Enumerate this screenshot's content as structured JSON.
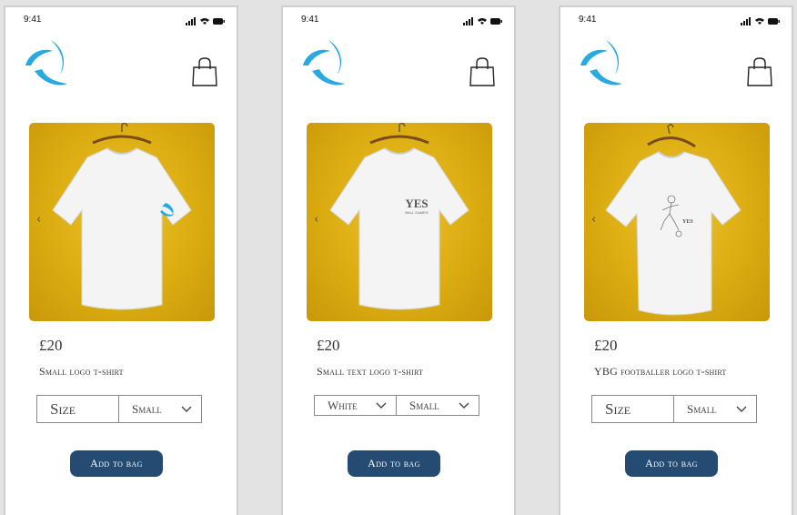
{
  "colors": {
    "accent": "#29a9e1",
    "button": "#244c72",
    "product_bg": "#dcad10"
  },
  "screens": [
    {
      "time": "9:41",
      "price": "£20",
      "name": "Small logo t-shirt",
      "print": "logo",
      "selectors": [
        "Size",
        "Small"
      ],
      "add_label": "Add to bag"
    },
    {
      "time": "9:41",
      "price": "£20",
      "name": "Small text logo t-shirt",
      "print": "text",
      "print_text": "YES",
      "print_subtext": "BALL GAMES",
      "selectors": [
        "White",
        "Small"
      ],
      "add_label": "Add to bag"
    },
    {
      "time": "9:41",
      "price": "£20",
      "name": "YBG footballer logo t-shirt",
      "print": "footballer",
      "print_text": "YES",
      "selectors": [
        "Size",
        "Small"
      ],
      "add_label": "Add to bag"
    }
  ],
  "icons": {
    "logo": "swirl-logo-icon",
    "bag": "shopping-bag-icon",
    "prev": "chevron-left-icon",
    "next": "chevron-right-icon",
    "dropdown": "chevron-down-icon"
  }
}
